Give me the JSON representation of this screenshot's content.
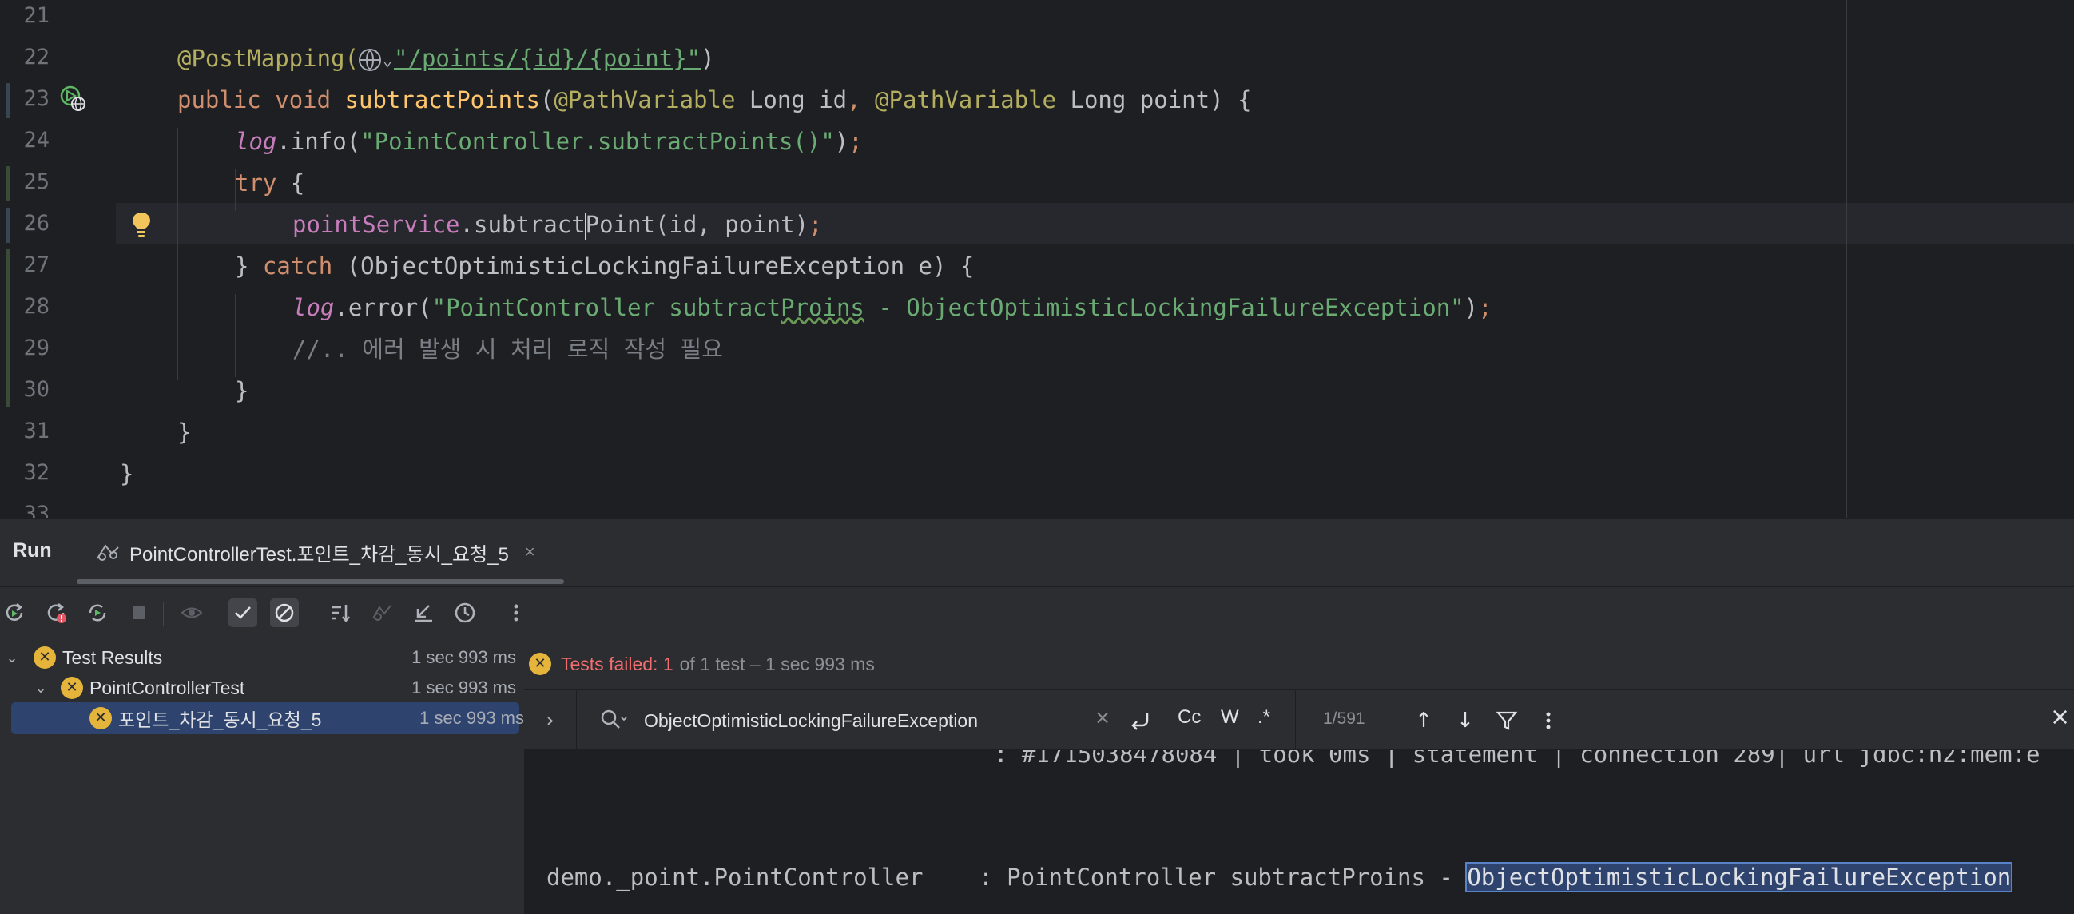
{
  "editor": {
    "line_numbers": [
      "21",
      "22",
      "23",
      "24",
      "25",
      "26",
      "27",
      "28",
      "29",
      "30",
      "31",
      "32",
      "33"
    ],
    "line22": {
      "annotation": "@PostMapping(",
      "path": "\"/points/{id}/{point}\"",
      "close": ")"
    },
    "line23": {
      "kw1": "public",
      "kw2": "void",
      "method": "subtractPoints",
      "open": "(",
      "ann1": "@PathVariable",
      "type1": " Long id",
      "comma": ", ",
      "ann2": "@PathVariable",
      "type2": " Long point",
      "close": ") {"
    },
    "line24": {
      "field": "log",
      "call": ".info(",
      "str": "\"PointController.subtractPoints()\"",
      "close": ")",
      "semi": ";"
    },
    "line25": {
      "kw": "try",
      "brace": " {"
    },
    "line26": {
      "field": "pointService",
      "dot": ".",
      "method_a": "subtract",
      "method_b": "Point",
      "args": "(id, point)",
      "semi": ";"
    },
    "line27": {
      "brace": "} ",
      "kw": "catch",
      "rest": " (ObjectOptimisticLockingFailureException e) {"
    },
    "line28": {
      "field": "log",
      "call": ".error(",
      "str_a": "\"PointController subtract",
      "str_typo": "Proins",
      "str_b": " - ObjectOptimisticLockingFailureException\"",
      "close": ")",
      "semi": ";"
    },
    "line29": {
      "comment": "//.. 에러 발생 시 처리 로직 작성 필요"
    },
    "line30": {
      "brace": "}"
    },
    "line31": {
      "brace": "}"
    },
    "line32": {
      "brace": "}"
    }
  },
  "run_window": {
    "title": "Run",
    "tab_label": "PointControllerTest.포인트_차감_동시_요청_5",
    "tab_close": "×",
    "toolbar_icons": [
      "rerun-icon",
      "rerun-failed-icon",
      "toggle-auto-test-icon",
      "stop-icon",
      "show-ignored-icon",
      "show-passed-icon",
      "show-ignored-toggle-icon",
      "sort-icon",
      "import-tests-icon",
      "collapse-icon",
      "history-icon",
      "more-options-icon"
    ]
  },
  "tree": {
    "items": [
      {
        "label": "Test Results",
        "duration": "1 sec 993 ms",
        "status": "failed"
      },
      {
        "label": "PointControllerTest",
        "duration": "1 sec 993 ms",
        "status": "failed"
      },
      {
        "label": "포인트_차감_동시_요청_5",
        "duration": "1 sec 993 ms",
        "status": "failed"
      }
    ]
  },
  "status": {
    "failed_text": "Tests failed: 1",
    "rest_text": "of 1 test – 1 sec 993 ms"
  },
  "search": {
    "query": "ObjectOptimisticLockingFailureException",
    "clear": "×",
    "match_case": "Cc",
    "words": "W",
    "regex": ".*",
    "count": "1/591",
    "close": "×"
  },
  "console": {
    "line1": ": #1715038478084 | took 0ms | statement | connection 289| url jdbc:h2:mem:e",
    "line2_logger": "demo._point.PointController    : PointController subtractProins - ",
    "line2_match": "ObjectOptimisticLockingFailureException"
  },
  "colors": {
    "editor_bg": "#1e1f22",
    "panel_bg": "#2b2d30",
    "keyword": "#cf8e6d",
    "string": "#6aab73",
    "annotation": "#b3ae60",
    "method_decl": "#ffc66d",
    "field": "#c77dbb",
    "fail": "#f26f6f",
    "fail_icon": "#e5b43b",
    "selection": "#2e436e"
  }
}
